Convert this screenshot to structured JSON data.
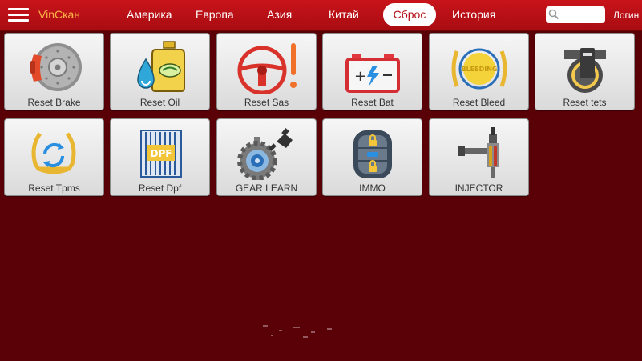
{
  "app": {
    "brand": "VinСкан"
  },
  "nav": {
    "items": [
      "Америка",
      "Европа",
      "Азия",
      "Китай",
      "Сброс",
      "История"
    ],
    "active_index": 4
  },
  "search": {
    "value": "",
    "placeholder": ""
  },
  "login_label": "Логин",
  "colors": {
    "background": "#5a0007",
    "topbar": "#b51016",
    "brand": "#ffb347",
    "tile": "#e8e8e8"
  },
  "tiles": [
    {
      "label": "Reset Brake",
      "icon": "brake-disc-icon"
    },
    {
      "label": "Reset Oil",
      "icon": "oil-bottle-icon"
    },
    {
      "label": "Reset Sas",
      "icon": "steering-wheel-icon"
    },
    {
      "label": "Reset Bat",
      "icon": "battery-icon"
    },
    {
      "label": "Reset Bleed",
      "icon": "bleeding-icon"
    },
    {
      "label": "Reset tets",
      "icon": "throttle-body-icon"
    },
    {
      "label": "Reset Tpms",
      "icon": "tire-pressure-icon"
    },
    {
      "label": "Reset Dpf",
      "icon": "dpf-filter-icon"
    },
    {
      "label": "GEAR LEARN",
      "icon": "gear-sensor-icon"
    },
    {
      "label": "IMMO",
      "icon": "immobilizer-icon"
    },
    {
      "label": "INJECTOR",
      "icon": "injector-icon"
    }
  ]
}
